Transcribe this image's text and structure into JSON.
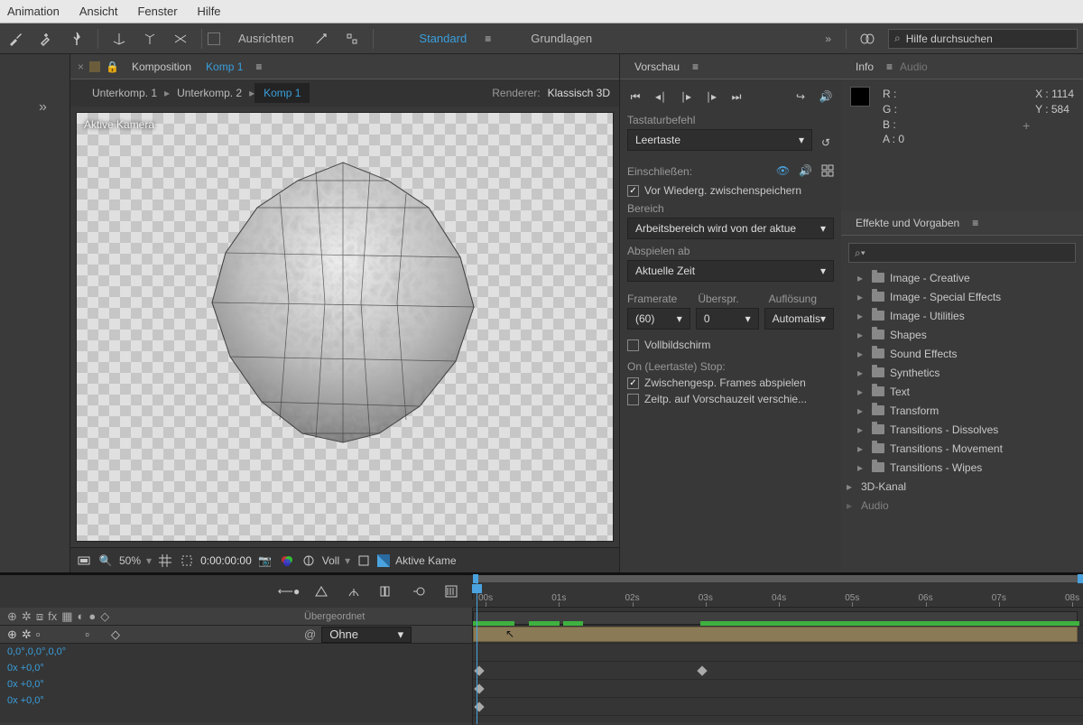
{
  "menubar": {
    "items": [
      "Animation",
      "Ansicht",
      "Fenster",
      "Hilfe"
    ]
  },
  "toolbar2": {
    "align": "Ausrichten",
    "workspaces": [
      "Standard",
      "Grundlagen"
    ],
    "search_placeholder": "Hilfe durchsuchen"
  },
  "composition": {
    "panel_label": "Komposition",
    "active": "Komp 1",
    "breadcrumbs": [
      "Unterkomp. 1",
      "Unterkomp. 2",
      "Komp 1"
    ],
    "renderer_label": "Renderer:",
    "renderer": "Klassisch 3D",
    "active_camera": "Aktive Kamera"
  },
  "viewport_footer": {
    "zoom": "50%",
    "timecode": "0:00:00:00",
    "resolution": "Voll",
    "camera": "Aktive Kame"
  },
  "preview": {
    "title": "Vorschau",
    "shortcut_label": "Tastaturbefehl",
    "shortcut": "Leertaste",
    "include_label": "Einschließen:",
    "cache_checkbox": "Vor Wiederg. zwischenspeichern",
    "range_label": "Bereich",
    "range": "Arbeitsbereich wird von der aktue",
    "playfrom_label": "Abspielen ab",
    "playfrom": "Aktuelle Zeit",
    "framerate_label": "Framerate",
    "skip_label": "Überspr.",
    "res_label": "Auflösung",
    "framerate": "(60)",
    "skip": "0",
    "res": "Automatis",
    "fullscreen": "Vollbildschirm",
    "onstop_label": "On (Leertaste) Stop:",
    "onstop_1": "Zwischengesp. Frames abspielen",
    "onstop_2": "Zeitp. auf Vorschauzeit verschie..."
  },
  "info": {
    "tab1": "Info",
    "tab2": "Audio",
    "r": "R :",
    "g": "G :",
    "b": "B :",
    "a": "A :  0",
    "x": "X : 1114",
    "y": "Y : 584"
  },
  "effects": {
    "title": "Effekte und Vorgaben",
    "items": [
      "Image - Creative",
      "Image - Special Effects",
      "Image - Utilities",
      "Shapes",
      "Sound Effects",
      "Synthetics",
      "Text",
      "Transform",
      "Transitions - Dissolves",
      "Transitions - Movement",
      "Transitions - Wipes"
    ],
    "cat1": "3D-Kanal",
    "cat2": "Audio"
  },
  "timeline": {
    "ticks": [
      "00s",
      "01s",
      "02s",
      "03s",
      "04s",
      "05s",
      "06s",
      "07s",
      "08s"
    ],
    "parent_label": "Übergeordnet",
    "parent_value": "Ohne",
    "rows": [
      "0,0°,0,0°,0,0°",
      "0x +0,0°",
      "0x +0,0°",
      "0x +0,0°"
    ]
  }
}
